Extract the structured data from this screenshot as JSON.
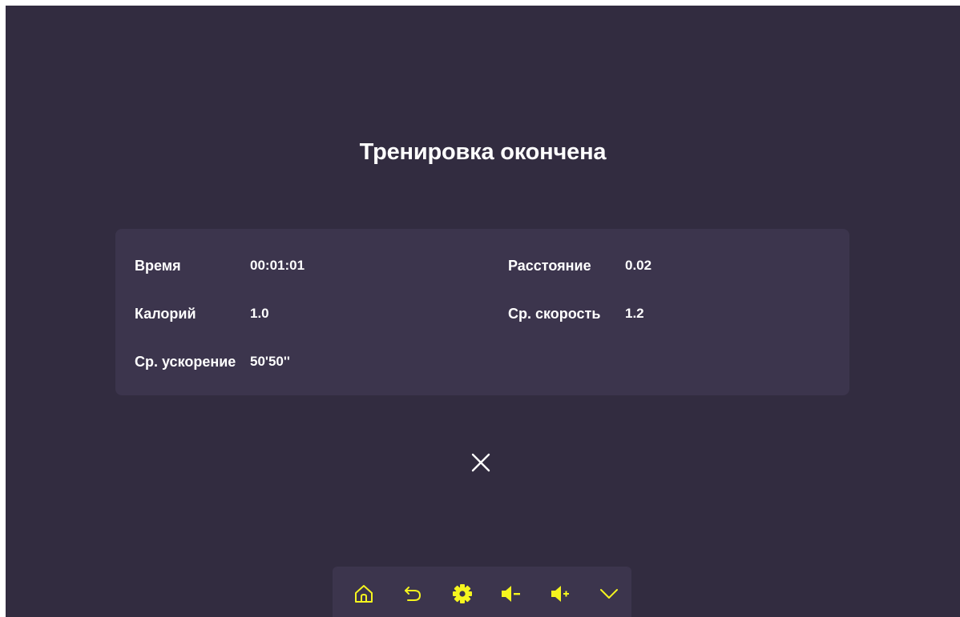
{
  "title": "Тренировка окончена",
  "stats": {
    "time": {
      "label": "Время",
      "value": "00:01:01"
    },
    "distance": {
      "label": "Расстояние",
      "value": "0.02"
    },
    "calories": {
      "label": "Калорий",
      "value": "1.0"
    },
    "avg_speed": {
      "label": "Ср. скорость",
      "value": "1.2"
    },
    "avg_acceleration": {
      "label": "Ср. ускорение",
      "value": "50'50''"
    }
  },
  "close_icon": "close-icon",
  "toolbar": {
    "icons": [
      "home-icon",
      "back-icon",
      "settings-icon",
      "volume-down-icon",
      "volume-up-icon",
      "chevron-down-icon"
    ]
  },
  "colors": {
    "background": "#322c40",
    "card": "#3c354d",
    "accent": "#f5f51e",
    "text": "#ffffff"
  }
}
